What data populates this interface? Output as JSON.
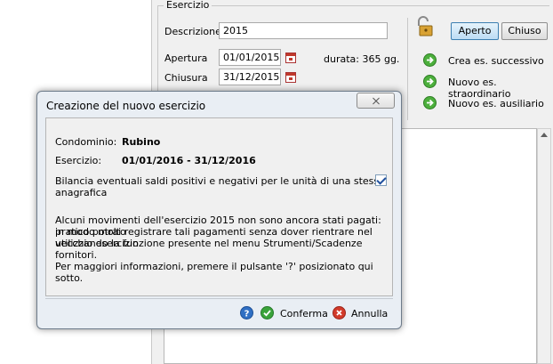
{
  "background": {
    "group_title": "Esercizio",
    "descrizione_label": "Descrizione",
    "descrizione_value": "2015",
    "apertura_label": "Apertura",
    "apertura_value": "01/01/2015",
    "chiusura_label": "Chiusura",
    "chiusura_value": "31/12/2015",
    "durata_text": "durata: 365 gg.",
    "aperto_button": "Aperto",
    "chiuso_button": "Chiuso",
    "actions": [
      {
        "label": "Crea es. successivo",
        "icon": "green-arrow-icon"
      },
      {
        "label": "Nuovo es. straordinario",
        "icon": "green-arrow-icon"
      },
      {
        "label": "Nuovo es. ausiliario",
        "icon": "green-arrow-icon"
      }
    ]
  },
  "dialog": {
    "title": "Creazione del nuovo esercizio",
    "condominio_label": "Condominio:",
    "condominio_value": "Rubino",
    "esercizio_label": "Esercizio:",
    "esercizio_value": "01/01/2016 - 31/12/2016",
    "checkbox_label": "Bilancia eventuali saldi positivi e negativi per le unità di una stessa anagrafica",
    "checkbox_checked": true,
    "warning_line1": "Alcuni movimenti dell'esercizio 2015 non sono ancora stati pagati: in modo molto",
    "warning_line2": "pratico potrai registrare tali pagamenti senza dover rientrare nel vecchio esercizio",
    "warning_line3": "utilizzando la funzione presente nel menu Strumenti/Scadenze fornitori.",
    "info_line": "Per maggiori informazioni, premere il pulsante '?' posizionato qui sotto.",
    "confirm_label": "Conferma",
    "cancel_label": "Annulla"
  },
  "colors": {
    "accent": "#3c7fb1",
    "confirm_green": "#3aa33a",
    "cancel_red": "#d23a2a",
    "help_blue": "#2f6fc4"
  }
}
